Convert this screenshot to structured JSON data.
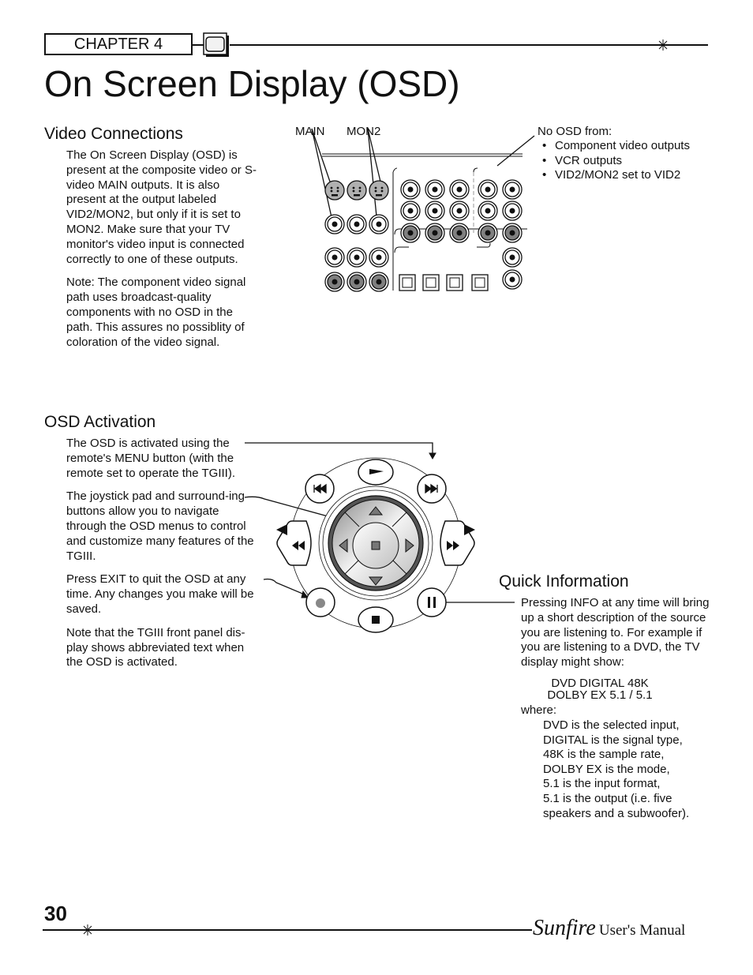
{
  "header": {
    "chapter_label": "CHAPTER 4",
    "page_title": "On Screen Display (OSD)"
  },
  "video_connections": {
    "heading": "Video Connections",
    "paragraphs": [
      "The On Screen Display (OSD) is present at the composite video or S-video MAIN outputs. It is also present at the output labeled VID2/MON2, but only if it is set to MON2. Make sure that your TV monitor's video input is connected correctly to one of these outputs.",
      "Note: The component video signal path uses broadcast-quality components with no OSD in the path. This assures no possiblity of coloration of the video signal."
    ],
    "diagram_labels": {
      "main": "MAIN",
      "mon2": "MON2"
    },
    "no_osd": {
      "title": "No OSD from:",
      "items": [
        "Component video outputs",
        "VCR outputs",
        "VID2/MON2 set to VID2"
      ]
    }
  },
  "osd_activation": {
    "heading": "OSD Activation",
    "paragraphs": [
      "The OSD is activated using the remote's MENU button (with the remote set to operate the TGIII).",
      "The joystick pad and surround-ing buttons allow you to navigate through the OSD menus to control and customize many features of the TGIII.",
      "Press EXIT to quit the OSD at any time. Any changes you make will be saved.",
      "Note that the TGIII front panel dis-play shows abbreviated text when the OSD is activated."
    ]
  },
  "quick_information": {
    "heading": "Quick Information",
    "intro": "Pressing INFO at any time will bring up a short description of the source you are listening to. For example if you are listening to a DVD, the TV display might show:",
    "display_lines": [
      "DVD DIGITAL 48K",
      "DOLBY EX 5.1 / 5.1"
    ],
    "where_label": "where:",
    "where_items": [
      "DVD is the selected input,",
      "DIGITAL is the signal type,",
      "48K is the sample rate,",
      "DOLBY EX is the mode,",
      "5.1 is the input format,",
      "5.1 is the output (i.e. five",
      "speakers and a subwoofer)."
    ]
  },
  "footer": {
    "page_number": "30",
    "brand": "Sunfire",
    "manual_label": "User's Manual"
  },
  "icons": {
    "header_tv": "tv-icon",
    "star": "star-icon",
    "remote": "remote-joystick-diagram",
    "rear_panel": "rear-panel-connector-diagram"
  },
  "colors": {
    "text": "#111111",
    "jack_gray": "#808080",
    "svideo_gray": "#b0b0b0"
  }
}
